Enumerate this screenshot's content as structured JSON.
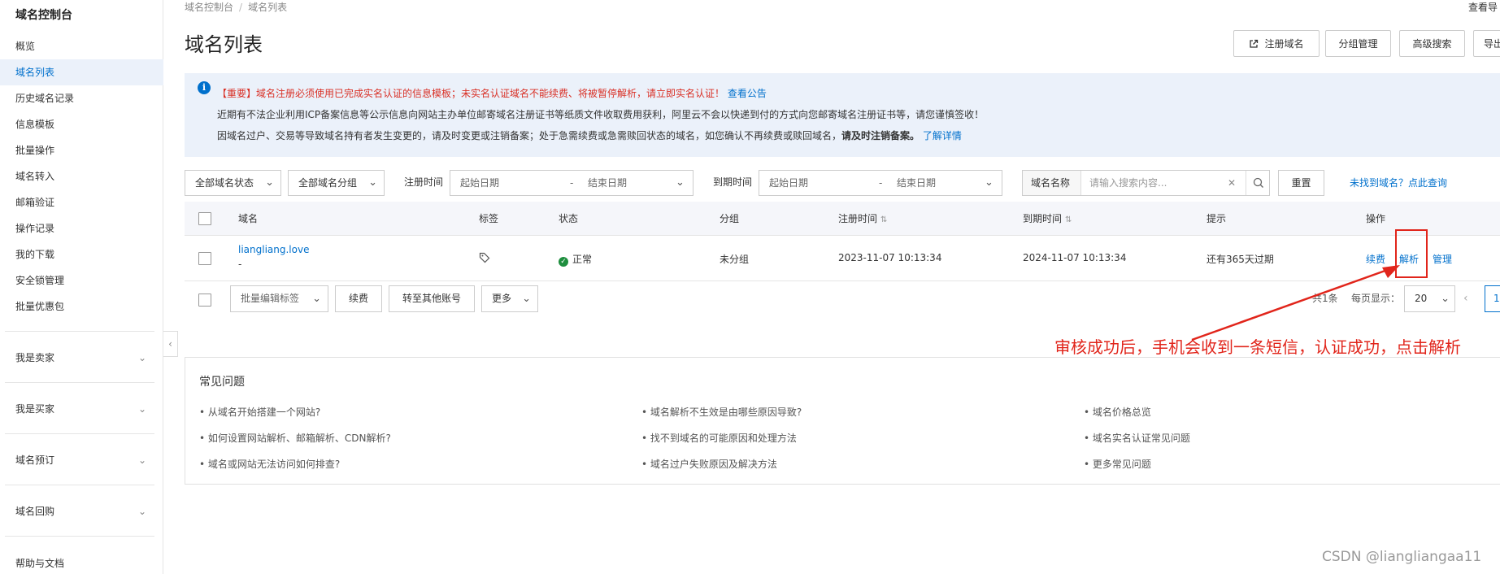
{
  "sidebar": {
    "title": "域名控制台",
    "items": [
      {
        "label": "概览"
      },
      {
        "label": "域名列表",
        "active": true
      },
      {
        "label": "历史域名记录"
      },
      {
        "label": "信息模板"
      },
      {
        "label": "批量操作"
      },
      {
        "label": "域名转入"
      },
      {
        "label": "邮箱验证"
      },
      {
        "label": "操作记录"
      },
      {
        "label": "我的下载"
      },
      {
        "label": "安全锁管理"
      },
      {
        "label": "批量优惠包"
      }
    ],
    "groups": [
      {
        "label": "我是卖家"
      },
      {
        "label": "我是买家"
      },
      {
        "label": "域名预订"
      },
      {
        "label": "域名回购"
      }
    ],
    "help": "帮助与文档"
  },
  "breadcrumb": {
    "root": "域名控制台",
    "current": "域名列表"
  },
  "top_right_link": "查看导",
  "page_title": "域名列表",
  "header_buttons": {
    "register": "注册域名",
    "group_manage": "分组管理",
    "advanced_search": "高级搜索",
    "export": "导出"
  },
  "notice": {
    "line1_prefix": "【重要】域名注册必须使用已完成实名认证的信息模板；未实名认证域名不能续费、将被暂停解析，请立即实名认证！",
    "line1_link": "查看公告",
    "line2": "近期有不法企业利用ICP备案信息等公示信息向网站主办单位邮寄域名注册证书等纸质文件收取费用获利，阿里云不会以快递到付的方式向您邮寄域名注册证书等，请您谨慎签收！",
    "line3_normal": "因域名过户、交易等导致域名持有者发生变更的，请及时变更或注销备案；处于急需续费或急需赎回状态的域名，如您确认不再续费或赎回域名，",
    "line3_bold": "请及时注销备案。",
    "line3_link": "了解详情"
  },
  "filters": {
    "status": "全部域名状态",
    "group": "全部域名分组",
    "reg_time_label": "注册时间",
    "exp_time_label": "到期时间",
    "start_placeholder": "起始日期",
    "dash": "-",
    "end_placeholder": "结束日期",
    "search_type": "域名名称",
    "search_placeholder": "请输入搜索内容...",
    "reset": "重置",
    "not_found": "未找到域名？点此查询"
  },
  "table": {
    "columns": {
      "domain": "域名",
      "tag": "标签",
      "status": "状态",
      "group": "分组",
      "reg_time": "注册时间",
      "exp_time": "到期时间",
      "tip": "提示",
      "actions": "操作"
    },
    "rows": [
      {
        "domain": "liangliang.love",
        "sub": "-",
        "status": "正常",
        "group": "未分组",
        "reg_time": "2023-11-07 10:13:34",
        "exp_time": "2024-11-07 10:13:34",
        "tip": "还有365天过期",
        "action_renew": "续费",
        "action_resolve": "解析",
        "action_manage": "管理"
      }
    ]
  },
  "bulk": {
    "edit_tags": "批量编辑标签",
    "renew": "续费",
    "transfer": "转至其他账号",
    "more": "更多"
  },
  "pagination": {
    "total": "共1条",
    "per_page_label": "每页显示：",
    "page_size": "20",
    "current_page": "1"
  },
  "annotation": "审核成功后，手机会收到一条短信，认证成功，点击解析",
  "faq": {
    "title": "常见问题",
    "col1": [
      "从域名开始搭建一个网站?",
      "如何设置网站解析、邮箱解析、CDN解析?",
      "域名或网站无法访问如何排查?"
    ],
    "col2": [
      "域名解析不生效是由哪些原因导致?",
      "找不到域名的可能原因和处理方法",
      "域名过户失败原因及解决方法"
    ],
    "col3": [
      "域名价格总览",
      "域名实名认证常见问题",
      "更多常见问题"
    ]
  },
  "watermark": "CSDN @liangliangaa11",
  "colors": {
    "primary": "#0070cc",
    "notice_bg": "#ebf1fa",
    "warning_red": "#d93026",
    "annotation_red": "#e1251b",
    "ok_green": "#1e8e3e"
  }
}
